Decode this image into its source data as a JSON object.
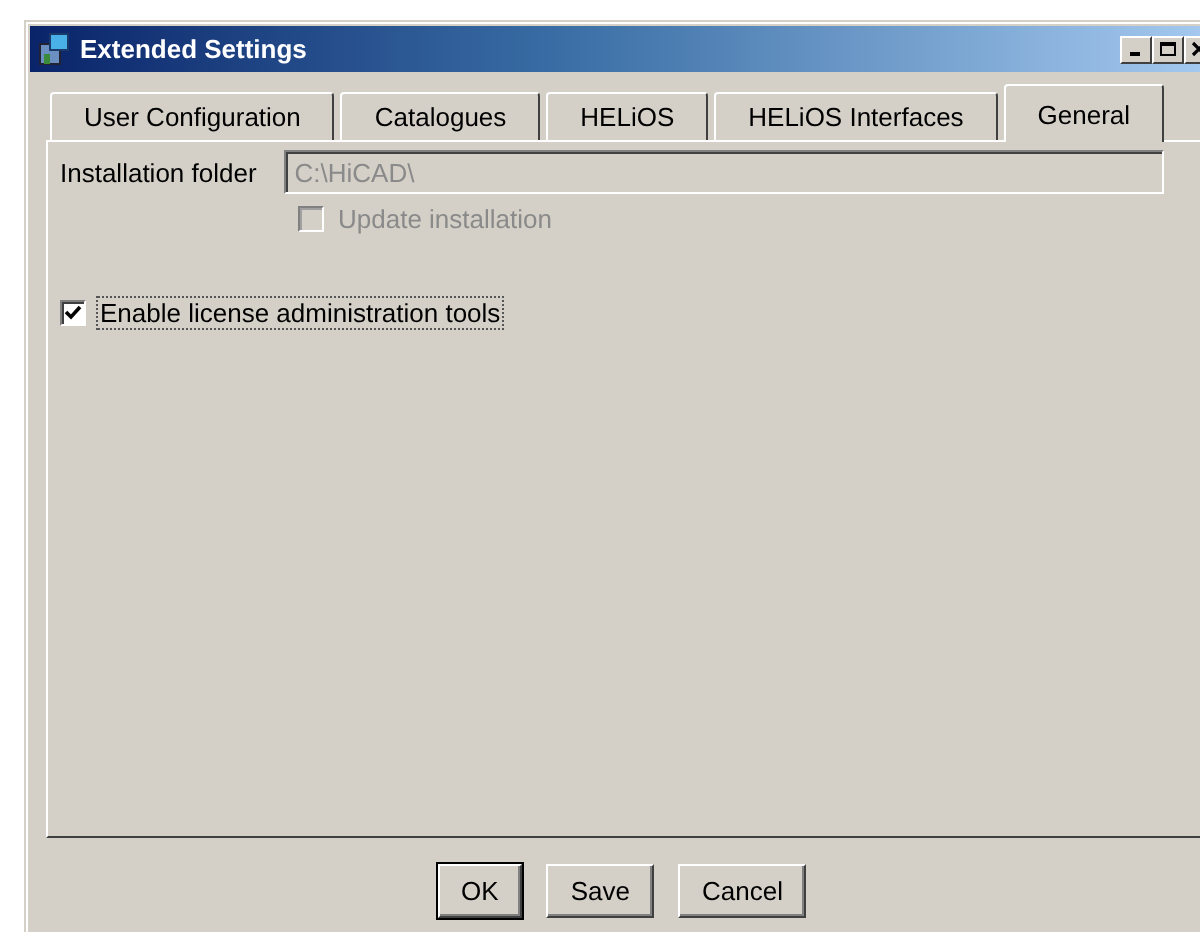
{
  "window": {
    "title": "Extended Settings"
  },
  "tabs": [
    {
      "label": "User Configuration",
      "selected": false
    },
    {
      "label": "Catalogues",
      "selected": false
    },
    {
      "label": "HELiOS",
      "selected": false
    },
    {
      "label": "HELiOS Interfaces",
      "selected": false
    },
    {
      "label": "General",
      "selected": true
    }
  ],
  "general": {
    "installation_folder": {
      "label": "Installation folder",
      "value": "C:\\HiCAD\\",
      "disabled": true
    },
    "update_installation": {
      "label": "Update installation",
      "checked": false,
      "disabled": true
    },
    "license_tools": {
      "label": "Enable license administration tools",
      "checked": true,
      "disabled": false,
      "focused": true
    }
  },
  "buttons": [
    {
      "label": "OK",
      "default": true
    },
    {
      "label": "Save",
      "default": false
    },
    {
      "label": "Cancel",
      "default": false
    }
  ]
}
